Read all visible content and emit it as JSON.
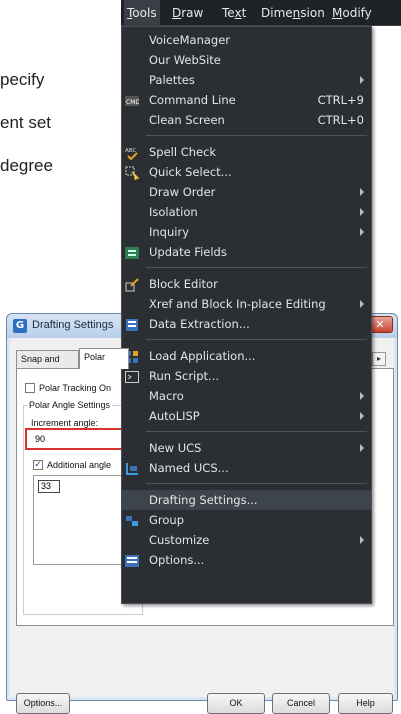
{
  "background_text": [
    "pecify",
    "ent set",
    "degree"
  ],
  "menubar": {
    "items": [
      {
        "label": "Tools",
        "ul": 0
      },
      {
        "label": "Draw",
        "ul": 0
      },
      {
        "label": "Text",
        "ul": 2
      },
      {
        "label": "Dimension",
        "ul": 4
      },
      {
        "label": "Modify",
        "ul": 0
      }
    ]
  },
  "tools_menu": {
    "items": [
      {
        "label": "VoiceManager"
      },
      {
        "label": "Our WebSite"
      },
      {
        "label": "Palettes",
        "submenu": true
      },
      {
        "label": "Command Line",
        "shortcut": "CTRL+9",
        "icon": "command-line-icon"
      },
      {
        "label": "Clean Screen",
        "shortcut": "CTRL+0"
      },
      {
        "sep": true
      },
      {
        "label": "Spell Check",
        "icon": "spell-check-icon"
      },
      {
        "label": "Quick Select...",
        "icon": "quick-select-icon"
      },
      {
        "label": "Draw Order",
        "submenu": true
      },
      {
        "label": "Isolation",
        "submenu": true
      },
      {
        "label": "Inquiry",
        "submenu": true
      },
      {
        "label": "Update Fields",
        "icon": "update-fields-icon"
      },
      {
        "sep": true
      },
      {
        "label": "Block Editor",
        "icon": "block-editor-icon"
      },
      {
        "label": "Xref and Block In-place Editing",
        "submenu": true
      },
      {
        "label": "Data Extraction...",
        "icon": "data-extraction-icon"
      },
      {
        "sep": true
      },
      {
        "label": "Load Application...",
        "icon": "load-application-icon"
      },
      {
        "label": "Run Script...",
        "icon": "run-script-icon"
      },
      {
        "label": "Macro",
        "submenu": true
      },
      {
        "label": "AutoLISP",
        "submenu": true
      },
      {
        "sep": true
      },
      {
        "label": "New UCS",
        "submenu": true
      },
      {
        "label": "Named UCS...",
        "icon": "named-ucs-icon"
      },
      {
        "sep": true
      },
      {
        "label": "Drafting Settings...",
        "highlighted": true
      },
      {
        "label": "Group",
        "icon": "group-icon"
      },
      {
        "label": "Customize",
        "submenu": true
      },
      {
        "label": "Options...",
        "icon": "options-icon"
      }
    ]
  },
  "dialog": {
    "title": "Drafting Settings",
    "tabs": [
      "Snap and GRid",
      "Polar"
    ],
    "polar_tracking_label": "Polar Tracking On",
    "polar_angle_settings_label": "Polar Angle Settings",
    "increment_angle_label": "Increment angle:",
    "increment_angle_value": "90",
    "additional_angles_label": "Additional angle",
    "additional_angles_item": "33",
    "options_button": "Options...",
    "ok_button": "OK",
    "cancel_button": "Cancel",
    "help_button": "Help"
  }
}
